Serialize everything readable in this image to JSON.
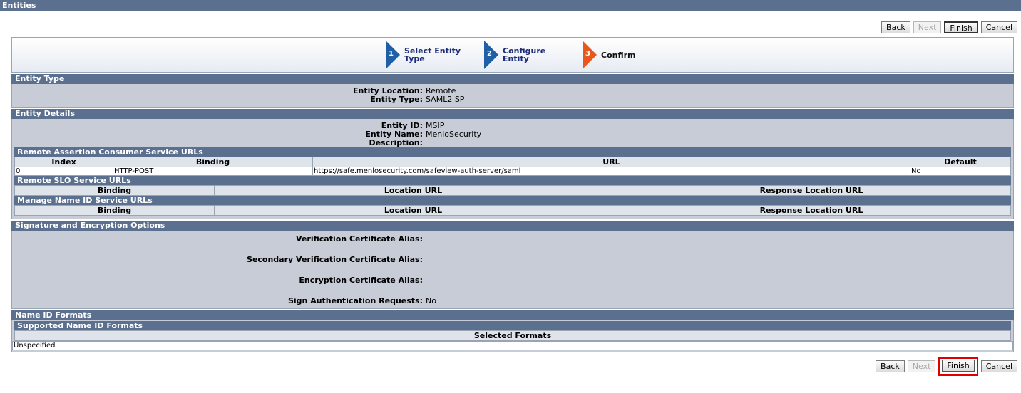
{
  "window": {
    "title": "Entities"
  },
  "buttons": {
    "back": "Back",
    "next": "Next",
    "finish": "Finish",
    "cancel": "Cancel"
  },
  "wizard": {
    "steps": [
      {
        "number": "1",
        "line1": "Select Entity",
        "line2": "Type",
        "color": "#1f5fa8"
      },
      {
        "number": "2",
        "line1": "Configure",
        "line2": "Entity",
        "color": "#1f5fa8"
      },
      {
        "number": "3",
        "line1": "Confirm",
        "line2": "",
        "color": "#e8581c"
      }
    ]
  },
  "entity_type": {
    "header": "Entity Type",
    "location_label": "Entity Location:",
    "location_value": "Remote",
    "type_label": "Entity Type:",
    "type_value": "SAML2 SP"
  },
  "entity_details": {
    "header": "Entity Details",
    "id_label": "Entity ID:",
    "id_value": "MSIP",
    "name_label": "Entity Name:",
    "name_value": "MenloSecurity",
    "description_label": "Description:",
    "description_value": "",
    "acs": {
      "header": "Remote Assertion Consumer Service URLs",
      "columns": [
        "Index",
        "Binding",
        "URL",
        "Default"
      ],
      "rows": [
        {
          "index": "0",
          "binding": "HTTP-POST",
          "url": "https://safe.menlosecurity.com/safeview-auth-server/saml",
          "default": "No"
        }
      ]
    },
    "slo": {
      "header": "Remote SLO Service URLs",
      "columns": [
        "Binding",
        "Location URL",
        "Response Location URL"
      ]
    },
    "nameid_svc": {
      "header": "Manage Name ID Service URLs",
      "columns": [
        "Binding",
        "Location URL",
        "Response Location URL"
      ]
    }
  },
  "signature": {
    "header": "Signature and Encryption Options",
    "verification_label": "Verification Certificate Alias:",
    "verification_value": "",
    "secondary_label": "Secondary Verification Certificate Alias:",
    "secondary_value": "",
    "encryption_label": "Encryption Certificate Alias:",
    "encryption_value": "",
    "sign_label": "Sign Authentication Requests:",
    "sign_value": "No"
  },
  "name_id_formats": {
    "header": "Name ID Formats",
    "sub_header": "Supported Name ID Formats",
    "column": "Selected Formats",
    "rows": [
      "Unspecified"
    ]
  }
}
